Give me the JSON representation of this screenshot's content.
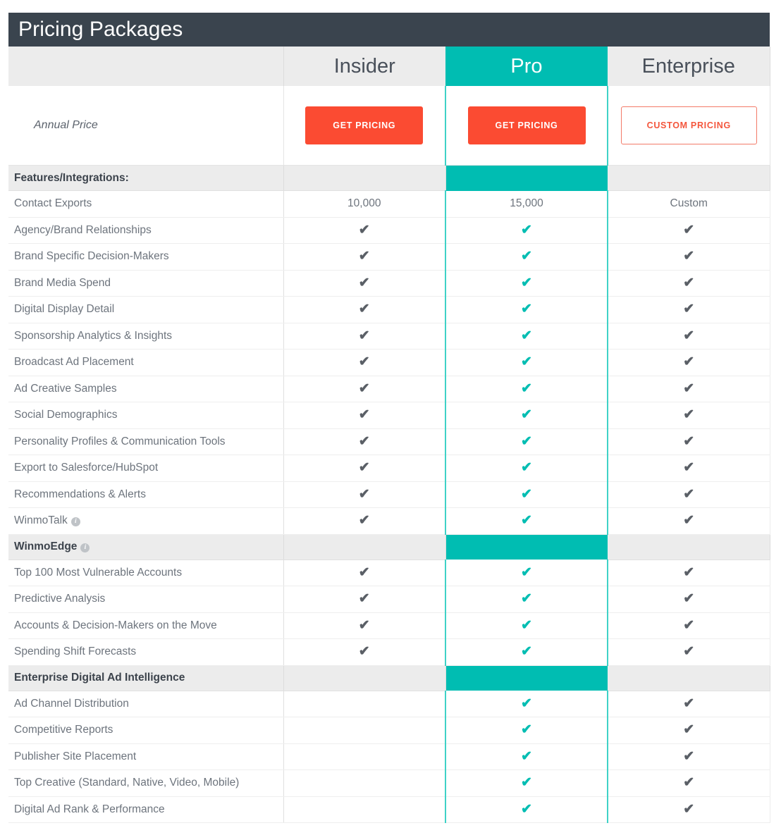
{
  "header": {
    "title": "Pricing Packages"
  },
  "plans": [
    {
      "name": "Insider",
      "highlight": false
    },
    {
      "name": "Pro",
      "highlight": true
    },
    {
      "name": "Enterprise",
      "highlight": false
    }
  ],
  "price_row": {
    "label": "Annual Price",
    "buttons": [
      {
        "label": "GET PRICING",
        "style": "solid"
      },
      {
        "label": "GET PRICING",
        "style": "solid"
      },
      {
        "label": "CUSTOM PRICING",
        "style": "outline"
      }
    ]
  },
  "sections": [
    {
      "title": "Features/Integrations:",
      "has_info_icon": false,
      "rows": [
        {
          "label": "Contact Exports",
          "info": false,
          "values": [
            "10,000",
            "15,000",
            "Custom"
          ]
        },
        {
          "label": "Agency/Brand Relationships",
          "info": false,
          "values": [
            "check",
            "check",
            "check"
          ]
        },
        {
          "label": "Brand Specific Decision-Makers",
          "info": false,
          "values": [
            "check",
            "check",
            "check"
          ]
        },
        {
          "label": "Brand Media Spend",
          "info": false,
          "values": [
            "check",
            "check",
            "check"
          ]
        },
        {
          "label": "Digital Display Detail",
          "info": false,
          "values": [
            "check",
            "check",
            "check"
          ]
        },
        {
          "label": "Sponsorship Analytics & Insights",
          "info": false,
          "values": [
            "check",
            "check",
            "check"
          ]
        },
        {
          "label": "Broadcast Ad Placement",
          "info": false,
          "values": [
            "check",
            "check",
            "check"
          ]
        },
        {
          "label": "Ad Creative Samples",
          "info": false,
          "values": [
            "check",
            "check",
            "check"
          ]
        },
        {
          "label": "Social Demographics",
          "info": false,
          "values": [
            "check",
            "check",
            "check"
          ]
        },
        {
          "label": "Personality Profiles & Communication Tools",
          "info": false,
          "values": [
            "check",
            "check",
            "check"
          ]
        },
        {
          "label": "Export to Salesforce/HubSpot",
          "info": false,
          "values": [
            "check",
            "check",
            "check"
          ]
        },
        {
          "label": "Recommendations & Alerts",
          "info": false,
          "values": [
            "check",
            "check",
            "check"
          ]
        },
        {
          "label": "WinmoTalk",
          "info": true,
          "values": [
            "check",
            "check",
            "check"
          ]
        }
      ]
    },
    {
      "title": "WinmoEdge",
      "has_info_icon": true,
      "rows": [
        {
          "label": "Top 100 Most Vulnerable Accounts",
          "info": false,
          "values": [
            "check",
            "check",
            "check"
          ]
        },
        {
          "label": "Predictive Analysis",
          "info": false,
          "values": [
            "check",
            "check",
            "check"
          ]
        },
        {
          "label": "Accounts & Decision-Makers on the Move",
          "info": false,
          "values": [
            "check",
            "check",
            "check"
          ]
        },
        {
          "label": "Spending Shift Forecasts",
          "info": false,
          "values": [
            "check",
            "check",
            "check"
          ]
        }
      ]
    },
    {
      "title": "Enterprise Digital Ad Intelligence",
      "has_info_icon": false,
      "rows": [
        {
          "label": "Ad Channel Distribution",
          "info": false,
          "values": [
            "",
            "check",
            "check"
          ]
        },
        {
          "label": "Competitive Reports",
          "info": false,
          "values": [
            "",
            "check",
            "check"
          ]
        },
        {
          "label": "Publisher Site Placement",
          "info": false,
          "values": [
            "",
            "check",
            "check"
          ]
        },
        {
          "label": "Top Creative (Standard, Native, Video, Mobile)",
          "info": false,
          "values": [
            "",
            "check",
            "check"
          ]
        },
        {
          "label": "Digital Ad Rank & Performance",
          "info": false,
          "values": [
            "",
            "check",
            "check"
          ]
        }
      ]
    }
  ],
  "icons": {
    "check_glyph": "✔",
    "info_glyph": "i"
  },
  "colors": {
    "title_bar": "#3a444e",
    "highlight_teal": "#00bdb2",
    "rail_teal": "#3fd2c7",
    "button_orange": "#fb4b32",
    "section_gray": "#ececec",
    "text_gray": "#6d747d"
  }
}
